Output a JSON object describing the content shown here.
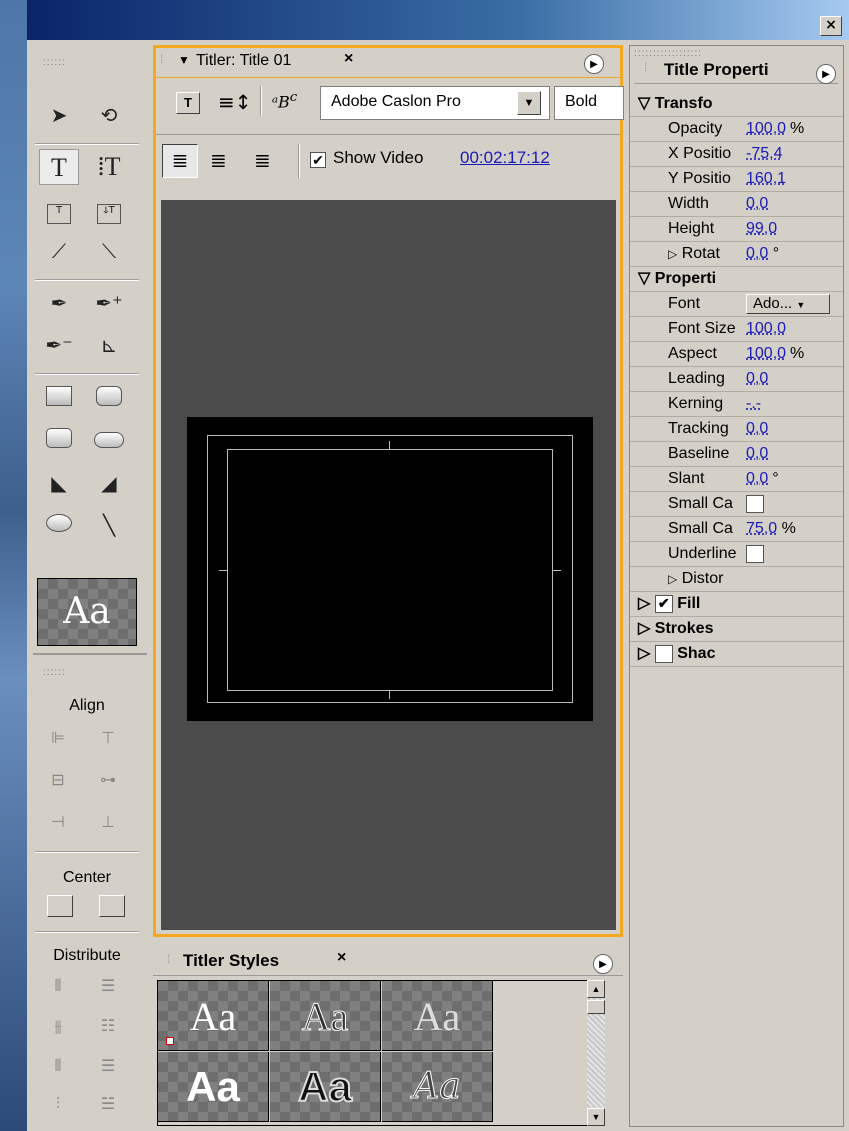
{
  "window": {
    "close_symbol": "×"
  },
  "tools_panel": {
    "style_swatch_text": "Aa",
    "align_label": "Align",
    "center_label": "Center",
    "distribute_label": "Distribute"
  },
  "titler": {
    "tab_label": "Titler: Title 01",
    "tab_close": "×",
    "font_name": "Adobe Caslon Pro",
    "font_style": "Bold",
    "show_video_label": "Show Video",
    "show_video_checked": true,
    "timecode": "00:02:17:12"
  },
  "styles_panel": {
    "tab_label": "Titler Styles",
    "tab_close": "×",
    "swatches": [
      "Aa",
      "Aa",
      "Aa",
      "Aa",
      "Aa",
      "Aa"
    ]
  },
  "properties": {
    "tab_label": "Title Properti",
    "transform_label": "Transfo",
    "rows_transform": [
      {
        "label": "Opacity",
        "value": "100,0",
        "unit": "%"
      },
      {
        "label": "X Positio",
        "value": "-75,4",
        "unit": ""
      },
      {
        "label": "Y Positio",
        "value": "160,1",
        "unit": ""
      },
      {
        "label": "Width",
        "value": "0,0",
        "unit": ""
      },
      {
        "label": "Height",
        "value": "99,0",
        "unit": ""
      }
    ],
    "rotation_label": "Rotat",
    "rotation_value": "0,0",
    "rotation_unit": "°",
    "properties_label": "Properti",
    "font_label": "Font",
    "font_value": "Ado...",
    "rows_props": [
      {
        "label": "Font Size",
        "value": "100,0",
        "unit": ""
      },
      {
        "label": "Aspect",
        "value": "100,0",
        "unit": "%"
      },
      {
        "label": "Leading",
        "value": "0,0",
        "unit": ""
      },
      {
        "label": "Kerning",
        "value": "-.-",
        "unit": ""
      },
      {
        "label": "Tracking",
        "value": "0,0",
        "unit": ""
      },
      {
        "label": "Baseline",
        "value": "0,0",
        "unit": ""
      },
      {
        "label": "Slant",
        "value": "0,0",
        "unit": "°"
      }
    ],
    "small_caps_label": "Small Ca",
    "small_caps_size_label": "Small Ca",
    "small_caps_size_value": "75,0",
    "small_caps_size_unit": "%",
    "underline_label": "Underline",
    "distort_label": "Distor",
    "fill_label": "Fill",
    "strokes_label": "Strokes",
    "shadow_label": "Shac"
  },
  "colors": {
    "accent_border": "#f4a820",
    "link_value": "#1a1ab8"
  }
}
